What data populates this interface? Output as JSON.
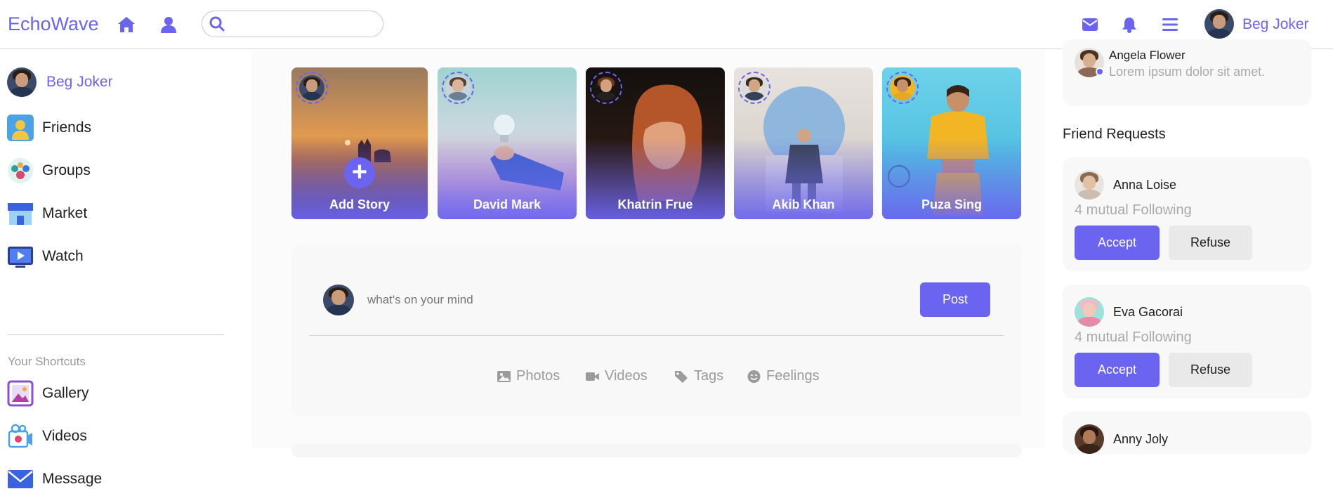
{
  "colors": {
    "accent": "#6a64f1",
    "muted_text": "#a9a9a9",
    "card_bg": "#f8f8f8"
  },
  "header": {
    "brand": "EchoWave",
    "icons": [
      "home-icon",
      "user-icon",
      "mail-icon",
      "bell-icon",
      "menu-icon"
    ],
    "search": {
      "value": "",
      "placeholder": ""
    },
    "user_name": "Beg Joker"
  },
  "left": {
    "profile_name": "Beg Joker",
    "items": [
      {
        "label": "Friends",
        "icon": "friends-icon"
      },
      {
        "label": "Groups",
        "icon": "groups-icon"
      },
      {
        "label": "Market",
        "icon": "market-icon"
      },
      {
        "label": "Watch",
        "icon": "watch-icon"
      }
    ],
    "shortcuts_title": "Your Shortcuts",
    "shortcuts": [
      {
        "label": "Gallery",
        "icon": "gallery-icon"
      },
      {
        "label": "Videos",
        "icon": "videos-icon"
      },
      {
        "label": "Message",
        "icon": "message-icon"
      }
    ]
  },
  "stories": [
    {
      "name": "Add Story",
      "add": true
    },
    {
      "name": "David Mark"
    },
    {
      "name": "Khatrin Frue"
    },
    {
      "name": "Akib Khan"
    },
    {
      "name": "Puza Sing"
    }
  ],
  "composer": {
    "placeholder": "what's on your mind",
    "post_label": "Post",
    "options": [
      {
        "label": "Photos",
        "icon": "photo-icon"
      },
      {
        "label": "Videos",
        "icon": "video-camera-icon"
      },
      {
        "label": "Tags",
        "icon": "tags-icon"
      },
      {
        "label": "Feelings",
        "icon": "smile-icon"
      }
    ]
  },
  "right": {
    "message": {
      "name": "Angela Flower",
      "text": "Lorem ipsum dolor sit amet."
    },
    "friend_requests_title": "Friend Requests",
    "requests": [
      {
        "name": "Anna Loise",
        "mutual": "4 mutual Following",
        "accept": "Accept",
        "refuse": "Refuse"
      },
      {
        "name": "Eva Gacorai",
        "mutual": "4 mutual Following",
        "accept": "Accept",
        "refuse": "Refuse"
      },
      {
        "name": "Anny Joly"
      }
    ]
  }
}
